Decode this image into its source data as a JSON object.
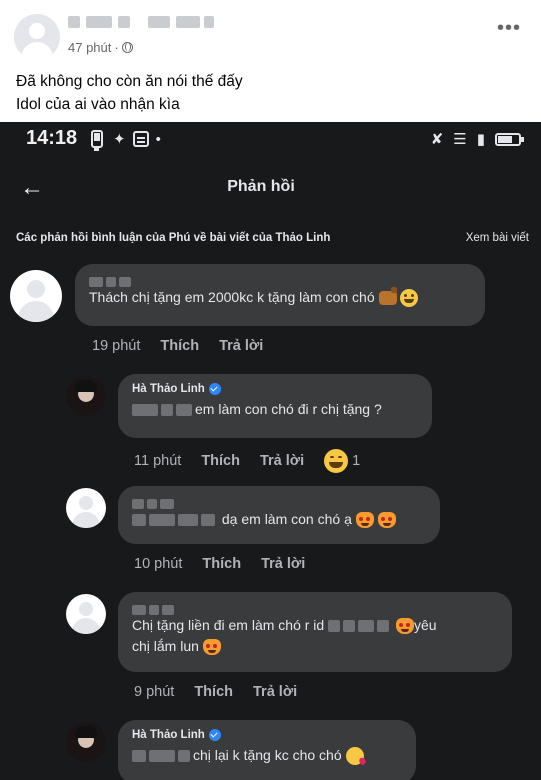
{
  "post": {
    "time": "47 phút",
    "separator": "·",
    "menu_glyph": "•••",
    "caption_lines": [
      "Đã không cho còn ăn nói thế đấy",
      "Idol của ai vào nhận kìa"
    ]
  },
  "phone": {
    "status_time": "14:18",
    "title": "Phản hồi",
    "context_label": "Các phản hồi bình luận của Phú về bài viết của Thảo Linh",
    "view_post": "Xem bài viết",
    "like_label": "Thích",
    "reply_label": "Trả lời"
  },
  "comments": [
    {
      "text": "Thách chị tặng em 2000kc k tặng làm con chó",
      "time": "19 phút"
    },
    {
      "author": "Hà Thảo Linh",
      "text": "em làm con chó đi r chị tặng ?",
      "time": "11 phút",
      "reaction_count": "1"
    },
    {
      "text": "dạ em làm con chó ạ",
      "time": "10 phút"
    },
    {
      "text_1": "Chị tặng liền đi em làm chó r id",
      "text_2": "yêu",
      "text_3": "chị lắm lun",
      "time": "9 phút"
    },
    {
      "author": "Hà Thảo Linh",
      "text": "chị lại k tặng kc cho chó"
    }
  ],
  "colors": {
    "dark_bg": "#18191a",
    "bubble": "#3a3b3c",
    "meta_text": "#b0b3b8",
    "verified": "#2d88ff"
  }
}
